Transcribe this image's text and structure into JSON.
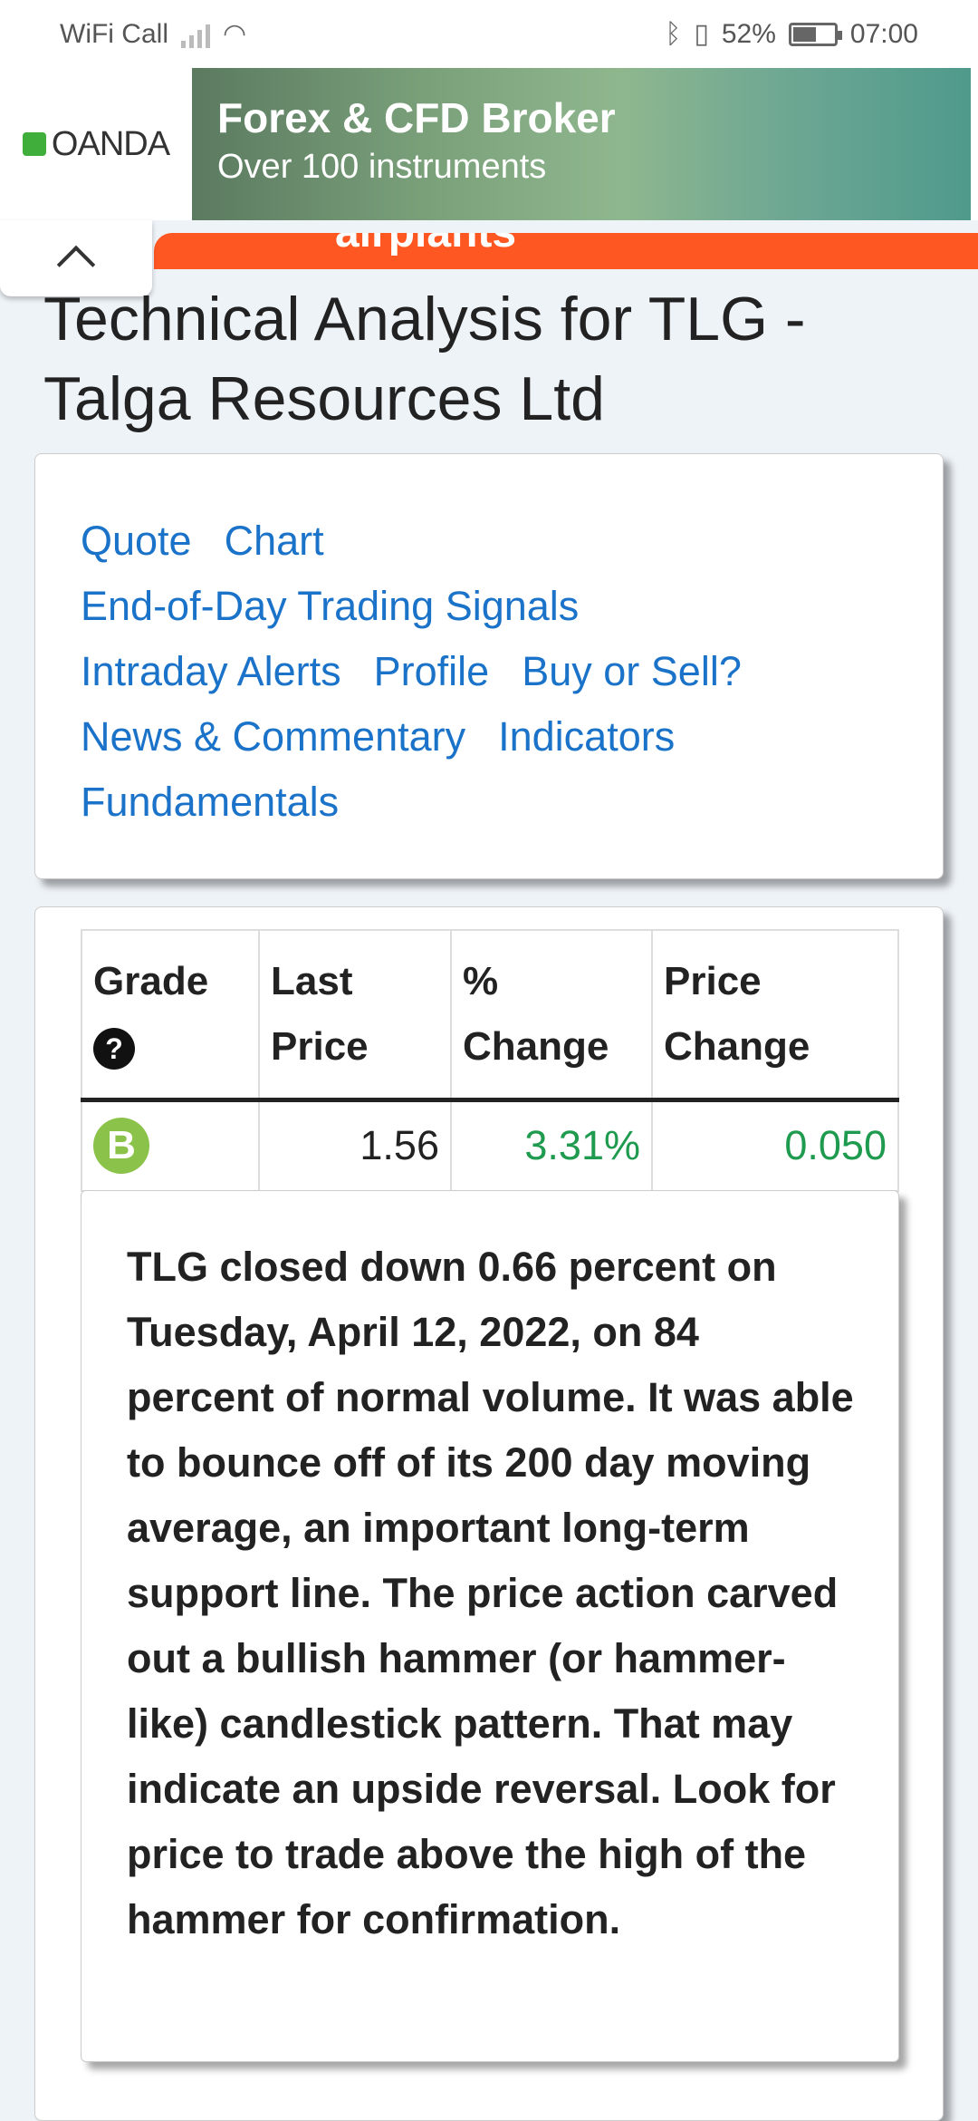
{
  "status_bar": {
    "carrier": "WiFi Call",
    "battery": "52%",
    "time": "07:00"
  },
  "ad": {
    "brand": "OANDA",
    "title": "Forex & CFD Broker",
    "subtitle": "Over 100 instruments"
  },
  "orange_banner_text": "airplants",
  "page": {
    "title": "Technical Analysis for TLG - Talga Resources Ltd"
  },
  "links": {
    "quote": "Quote",
    "chart": "Chart",
    "signals": "End-of-Day Trading Signals",
    "intraday": "Intraday Alerts",
    "profile": "Profile",
    "buy_sell": "Buy or Sell?",
    "news": "News & Commentary",
    "indicators": "Indicators",
    "fundamentals": "Fundamentals"
  },
  "table": {
    "headers": {
      "grade": "Grade",
      "last_price": "Last Price",
      "pct_change": "% Change",
      "price_change": "Price Change"
    },
    "help_icon": "?",
    "row": {
      "grade": "B",
      "last_price": "1.56",
      "pct_change": "3.31%",
      "price_change": "0.050"
    }
  },
  "summary": {
    "text": "TLG closed down 0.66 percent on Tuesday, April 12, 2022, on 84 percent of normal volume. It was able to bounce off of its 200 day moving average, an important long-term support line. The price action carved out a bullish hammer (or hammer-like) candlestick pattern. That may indicate an upside reversal. Look for price to trade above the high of the hammer for confirmation."
  },
  "colors": {
    "link": "#1a73c9",
    "positive": "#1e9b4e",
    "grade_b": "#8bc34a",
    "banner_orange": "#ff5722"
  }
}
